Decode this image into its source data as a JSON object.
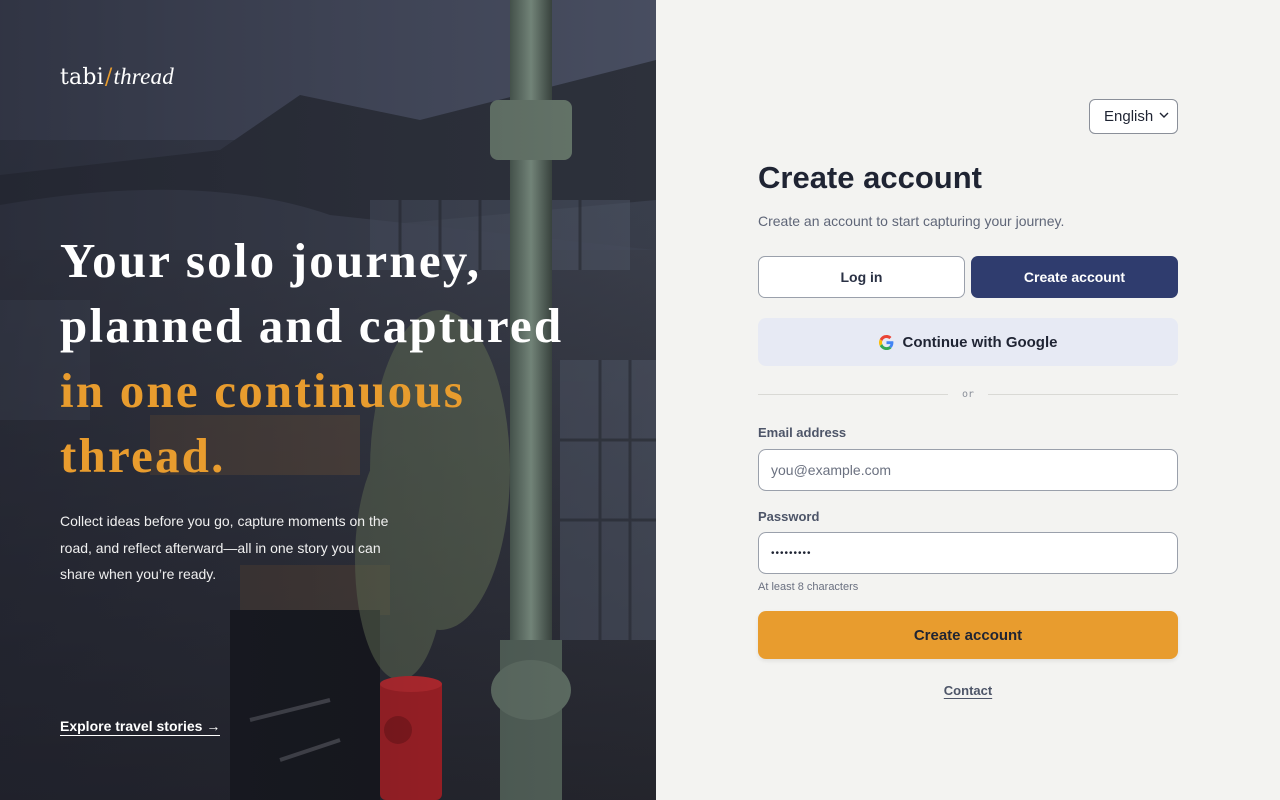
{
  "brand": {
    "name_main": "tabi",
    "name_slash": "/",
    "name_script": "thread",
    "accent_color": "#e89c2e"
  },
  "hero": {
    "headline_lines": [
      "Your solo journey,",
      "planned and captured",
      "in one continuous",
      "thread."
    ],
    "subtext": "Collect ideas before you go, capture moments on the road, and reflect afterward—all in one story you can share when you’re ready.",
    "explore_link": "Explore travel stories",
    "explore_arrow": "→"
  },
  "language": {
    "selected": "English"
  },
  "form": {
    "title": "Create account",
    "description": "Create an account to start capturing your journey.",
    "tabs": {
      "login": "Log in",
      "create": "Create account"
    },
    "google_button": "Continue with Google",
    "divider": "or",
    "email": {
      "label": "Email address",
      "placeholder": "you@example.com"
    },
    "password": {
      "label": "Password",
      "value": "•••••••••",
      "hint": "At least 8 characters"
    },
    "submit": "Create account"
  },
  "footer": {
    "contact": "Contact"
  },
  "colors": {
    "primary_navy": "#2f3c6e",
    "accent_orange": "#e89c2e",
    "panel_bg": "#f3f3f1",
    "google_bg": "#e7eaf4"
  }
}
